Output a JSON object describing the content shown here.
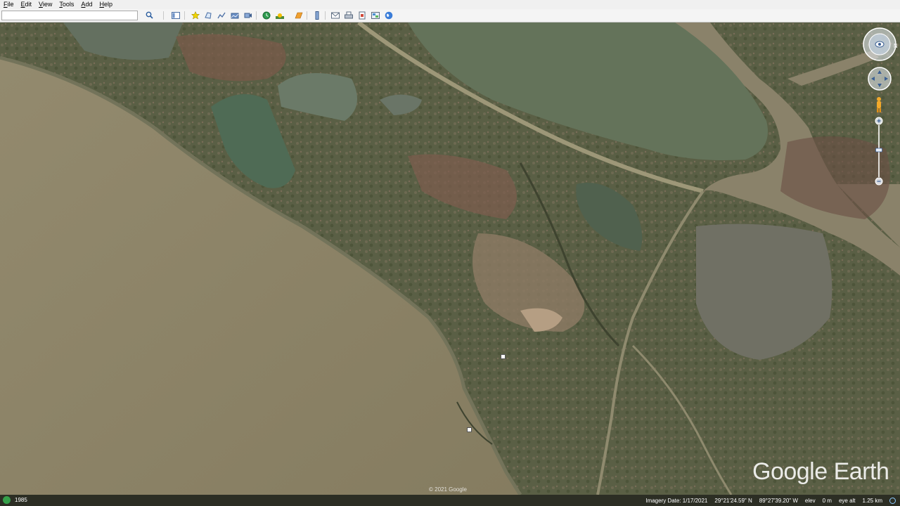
{
  "menu": {
    "items": [
      "File",
      "Edit",
      "View",
      "Tools",
      "Add",
      "Help"
    ]
  },
  "toolbar": {
    "search_value": "",
    "buttons": [
      "search-icon",
      "sidebar-icon",
      "placemark-icon",
      "polygon-icon",
      "path-icon",
      "image-overlay-icon",
      "record-tour-icon",
      "historical-imagery-icon",
      "sunlight-icon",
      "planets-icon",
      "ruler-icon",
      "email-icon",
      "print-icon",
      "save-image-icon",
      "maps-icon",
      "earth-icon"
    ]
  },
  "map": {
    "copyright": "© 2021 Google",
    "watermark": "Google Earth"
  },
  "statusbar": {
    "year": "1985",
    "imagery_date": "Imagery Date: 1/17/2021",
    "lat": "29°21'24.59\" N",
    "lon": "89°27'39.20\" W",
    "elev_label": "elev",
    "elev_value": "0 m",
    "eye_alt": "eye alt",
    "eye_alt_value": "1.25 km"
  },
  "colors": {
    "water": "#8c8468",
    "marsh": "#5b6046",
    "channel": "#4f6b55",
    "road": "#9d9778"
  }
}
